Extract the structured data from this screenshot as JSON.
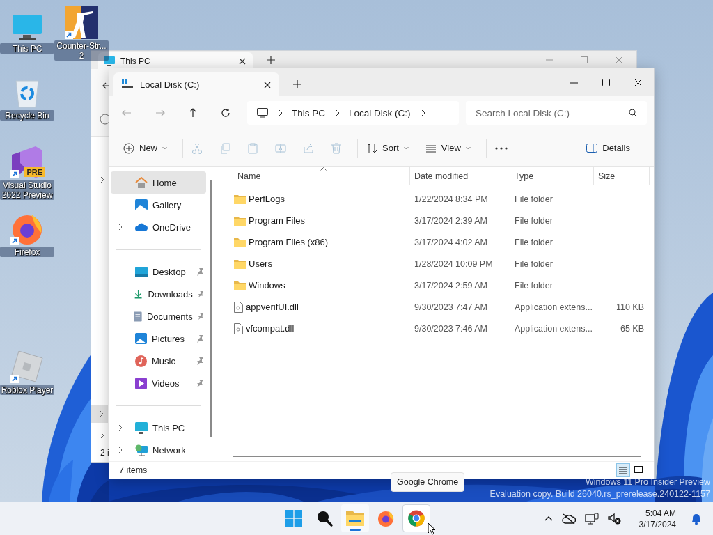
{
  "desktop": {
    "icons": [
      {
        "label": "This PC",
        "kind": "pc",
        "shortcut": false
      },
      {
        "label": "Counter-Str... 2",
        "kind": "game",
        "shortcut": true
      },
      {
        "label": "Recycle Bin",
        "kind": "bin",
        "shortcut": false
      },
      {
        "label": "Visual Studio 2022 Preview",
        "kind": "vs",
        "shortcut": true,
        "badge": "PRE"
      },
      {
        "label": "Firefox",
        "kind": "firefox",
        "shortcut": true
      },
      {
        "label": "Roblox Player",
        "kind": "roblox",
        "shortcut": true
      }
    ],
    "watermark": [
      "Windows 11 Pro Insider Preview",
      "Evaluation copy. Build 26040.rs_prerelease.240122-1157"
    ]
  },
  "back_window": {
    "tab_title": "This PC",
    "status_text": "2 i"
  },
  "window": {
    "tab_title": "Local Disk (C:)",
    "breadcrumbs": [
      "This PC",
      "Local Disk (C:)"
    ],
    "search": {
      "placeholder": "Search Local Disk (C:)"
    },
    "toolbar": [
      [
        {
          "kind": "new",
          "label": "New",
          "disabled": false
        }
      ],
      [
        {
          "kind": "cut",
          "disabled": true
        },
        {
          "kind": "copy",
          "disabled": true
        },
        {
          "kind": "paste",
          "disabled": true
        },
        {
          "kind": "rename",
          "disabled": true
        },
        {
          "kind": "share",
          "disabled": true
        },
        {
          "kind": "delete",
          "disabled": true
        }
      ],
      [
        {
          "kind": "sort",
          "label": "Sort",
          "disabled": false
        },
        {
          "kind": "view",
          "label": "View",
          "disabled": false
        }
      ],
      [
        {
          "kind": "more",
          "disabled": false
        }
      ]
    ],
    "details_button": "Details",
    "sidebar": [
      [
        {
          "label": "Home",
          "kind": "home",
          "selected": true,
          "pinned": false,
          "expandable": false
        },
        {
          "label": "Gallery",
          "kind": "gallery",
          "selected": false,
          "pinned": false,
          "expandable": false
        },
        {
          "label": "OneDrive",
          "kind": "cloud",
          "selected": false,
          "pinned": false,
          "expandable": true
        }
      ],
      [
        {
          "label": "Desktop",
          "kind": "desktop",
          "selected": false,
          "pinned": true,
          "expandable": false
        },
        {
          "label": "Downloads",
          "kind": "download",
          "selected": false,
          "pinned": true,
          "expandable": false
        },
        {
          "label": "Documents",
          "kind": "document",
          "selected": false,
          "pinned": true,
          "expandable": false
        },
        {
          "label": "Pictures",
          "kind": "picture",
          "selected": false,
          "pinned": true,
          "expandable": false
        },
        {
          "label": "Music",
          "kind": "music",
          "selected": false,
          "pinned": true,
          "expandable": false
        },
        {
          "label": "Videos",
          "kind": "video",
          "selected": false,
          "pinned": true,
          "expandable": false
        }
      ],
      [
        {
          "label": "This PC",
          "kind": "pc",
          "selected": false,
          "pinned": false,
          "expandable": true
        },
        {
          "label": "Network",
          "kind": "network",
          "selected": false,
          "pinned": false,
          "expandable": true
        }
      ]
    ],
    "columns": [
      "Name",
      "Date modified",
      "Type",
      "Size"
    ],
    "rows": [
      {
        "name": "PerfLogs",
        "kind": "folder",
        "date": "1/22/2024 8:34 PM",
        "type": "File folder"
      },
      {
        "name": "Program Files",
        "kind": "folder",
        "date": "3/17/2024 2:39 AM",
        "type": "File folder"
      },
      {
        "name": "Program Files (x86)",
        "kind": "folder",
        "date": "3/17/2024 4:02 AM",
        "type": "File folder"
      },
      {
        "name": "Users",
        "kind": "folder",
        "date": "1/28/2024 10:09 PM",
        "type": "File folder"
      },
      {
        "name": "Windows",
        "kind": "folder",
        "date": "3/17/2024 2:59 AM",
        "type": "File folder"
      },
      {
        "name": "appverifUI.dll",
        "kind": "file",
        "date": "9/30/2023 7:47 AM",
        "type": "Application extens...",
        "size": "110 KB"
      },
      {
        "name": "vfcompat.dll",
        "kind": "file",
        "date": "9/30/2023 7:46 AM",
        "type": "Application extens...",
        "size": "65 KB"
      }
    ],
    "status_bar": "7 items",
    "view_buttons": [
      {
        "kind": "details",
        "selected": true
      },
      {
        "kind": "tiles",
        "selected": false
      }
    ]
  },
  "tooltip": "Google Chrome",
  "taskbar": {
    "apps": [
      {
        "kind": "start",
        "running": false,
        "hovered": false
      },
      {
        "kind": "search",
        "running": false,
        "hovered": false
      },
      {
        "kind": "explorer",
        "running": true,
        "hovered": false
      },
      {
        "kind": "firefox",
        "running": false,
        "hovered": false
      },
      {
        "kind": "chrome",
        "running": false,
        "hovered": true
      }
    ],
    "time": "5:04 AM",
    "date": "3/17/2024"
  }
}
